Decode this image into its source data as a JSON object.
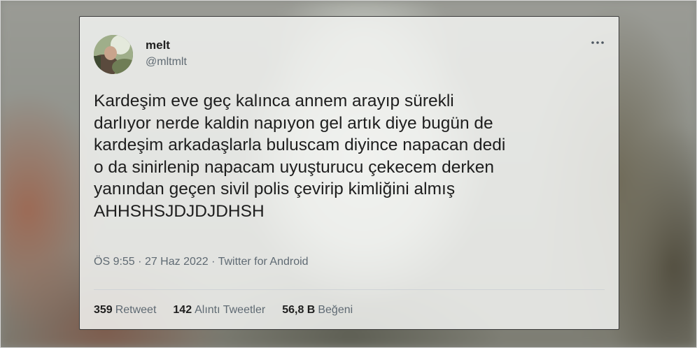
{
  "tweet": {
    "author": {
      "name": "melt",
      "handle": "@mltmlt"
    },
    "text_lines": [
      "Kardeşim eve geç kalınca annem arayıp sürekli",
      "darlıyor nerde kaldin napıyon gel artık diye bugün de",
      "kardeşim arkadaşlarla buluscam diyince napacan dedi",
      "o da sinirlenip napacam uyuşturucu çekecem derken",
      "yanından geçen sivil polis çevirip kimliğini almış",
      "AHHSHSJDJDJDHSH"
    ],
    "time": "ÖS 9:55",
    "separator": "·",
    "date": "27 Haz 2022",
    "source": "Twitter for Android",
    "stats": {
      "retweets_count": "359",
      "retweets_label": "Retweet",
      "quotes_count": "142",
      "quotes_label": "Alıntı Tweetler",
      "likes_count": "56,8 B",
      "likes_label": "Beğeni"
    }
  },
  "icons": {
    "more": "more-options-icon"
  }
}
